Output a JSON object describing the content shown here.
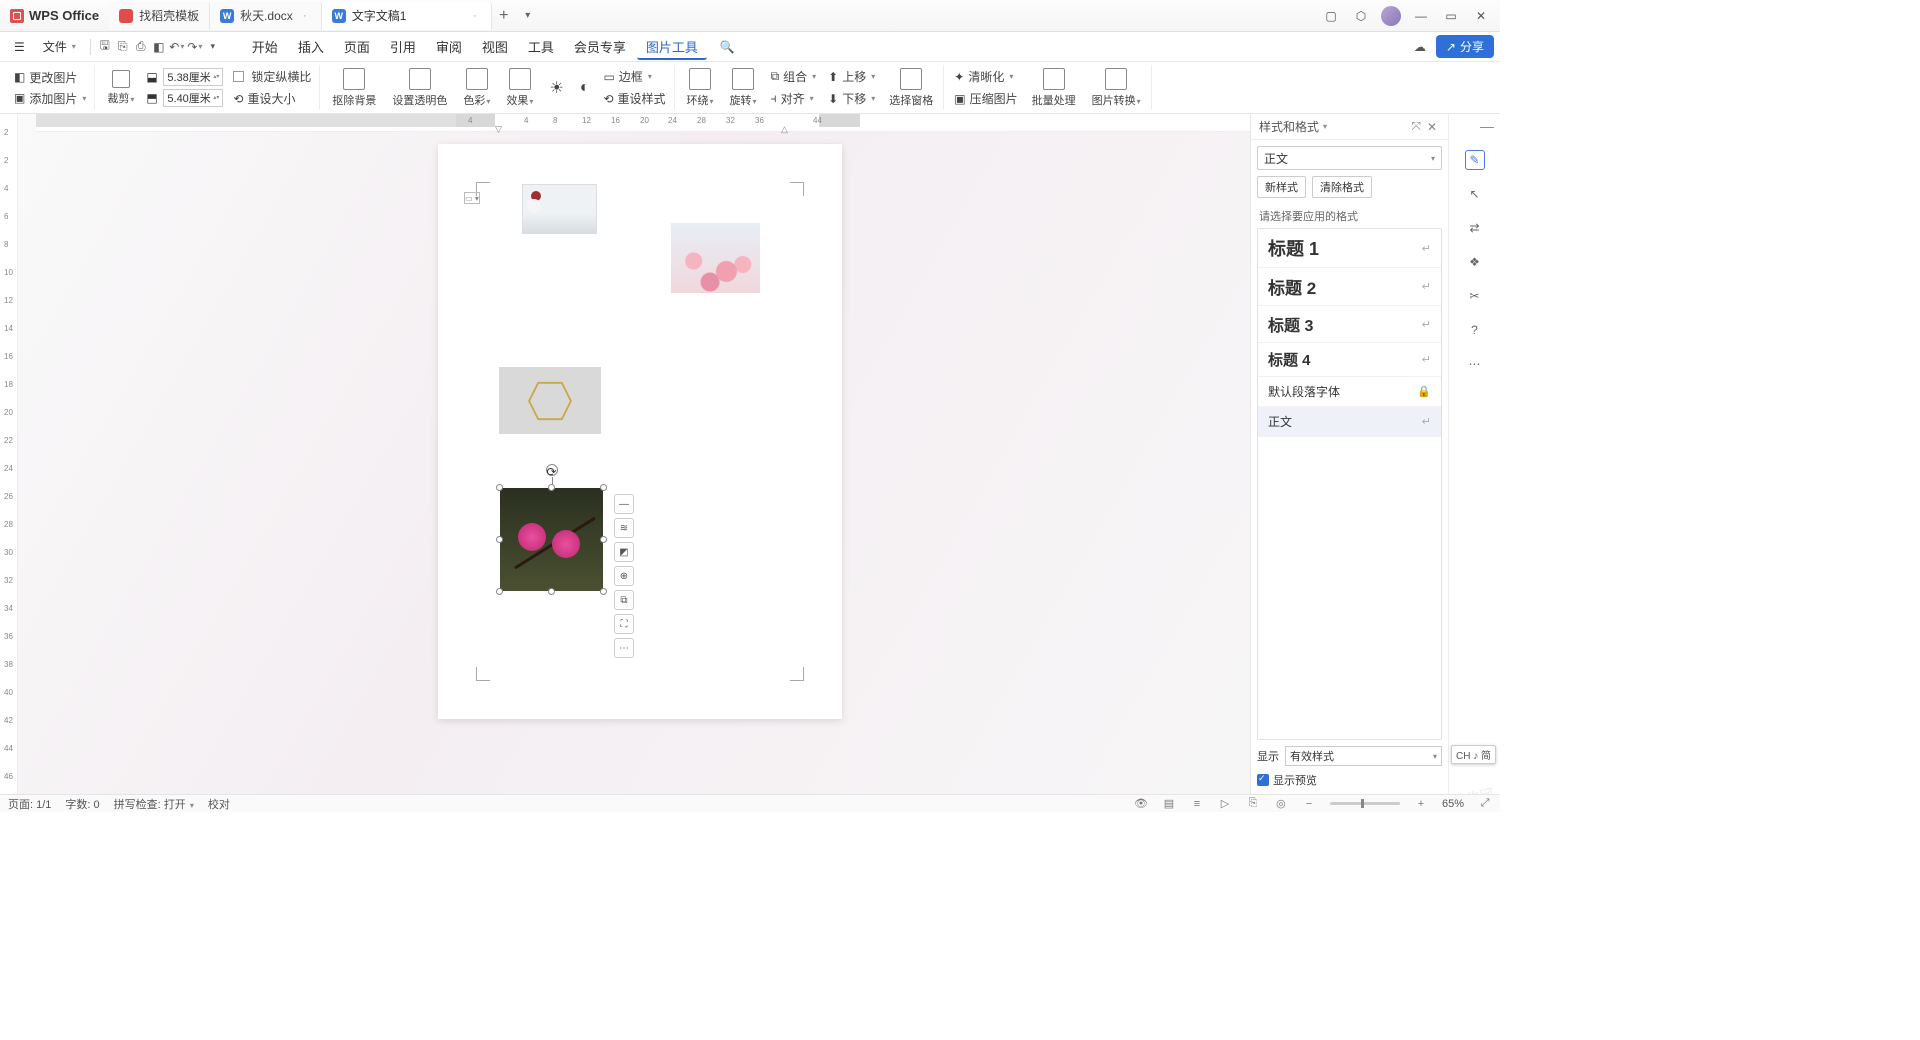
{
  "app": {
    "name": "WPS Office"
  },
  "tabs": [
    {
      "label": "找稻壳模板",
      "icon": "red"
    },
    {
      "label": "秋天.docx",
      "icon": "blue",
      "badge": "W"
    },
    {
      "label": "文字文稿1",
      "icon": "blue",
      "badge": "W",
      "active": true
    }
  ],
  "menubar": {
    "file": "文件",
    "items": [
      "开始",
      "插入",
      "页面",
      "引用",
      "审阅",
      "视图",
      "工具",
      "会员专享",
      "图片工具"
    ],
    "active": "图片工具",
    "share": "分享"
  },
  "ribbon": {
    "change_pic": "更改图片",
    "add_pic": "添加图片",
    "crop": "裁剪",
    "width": "5.38厘米",
    "height": "5.40厘米",
    "lock_ratio": "锁定纵横比",
    "reset_size": "重设大小",
    "remove_bg": "抠除背景",
    "transparency": "设置透明色",
    "color": "色彩",
    "effect": "效果",
    "border": "边框",
    "reset_style": "重设样式",
    "wrap": "环绕",
    "rotate": "旋转",
    "group": "组合",
    "align": "对齐",
    "up": "上移",
    "down": "下移",
    "sel_pane": "选择窗格",
    "sharpen": "清晰化",
    "compress": "压缩图片",
    "batch": "批量处理",
    "convert": "图片转换"
  },
  "hruler": {
    "marks": [
      "4",
      "4",
      "8",
      "12",
      "16",
      "20",
      "24",
      "28",
      "32",
      "36",
      "44"
    ]
  },
  "vruler_marks": [
    "2",
    "2",
    "4",
    "6",
    "8",
    "10",
    "12",
    "14",
    "16",
    "18",
    "20",
    "22",
    "24",
    "26",
    "28",
    "30",
    "32",
    "34",
    "36",
    "38",
    "40",
    "42",
    "44",
    "46"
  ],
  "float_toolbar": [
    "—",
    "≋",
    "◩",
    "⊕",
    "⧉",
    "⛶",
    "⋯"
  ],
  "side_panel": {
    "title": "样式和格式",
    "current": "正文",
    "new_style": "新样式",
    "clear_fmt": "清除格式",
    "apply_label": "请选择要应用的格式",
    "styles": [
      {
        "name": "标题 1",
        "cls": "h1"
      },
      {
        "name": "标题 2",
        "cls": "h2"
      },
      {
        "name": "标题 3",
        "cls": "h3"
      },
      {
        "name": "标题 4",
        "cls": "h4"
      },
      {
        "name": "默认段落字体",
        "cls": "",
        "lock": true
      },
      {
        "name": "正文",
        "cls": "",
        "sel": true
      }
    ],
    "show_label": "显示",
    "show_value": "有效样式",
    "preview_label": "显示预览"
  },
  "status": {
    "page": "页面: 1/1",
    "words": "字数: 0",
    "spell": "拼写检查: 打开",
    "proof": "校对",
    "zoom": "65%",
    "ime": "CH ♪ 简"
  },
  "watermark": "嗨牛网"
}
